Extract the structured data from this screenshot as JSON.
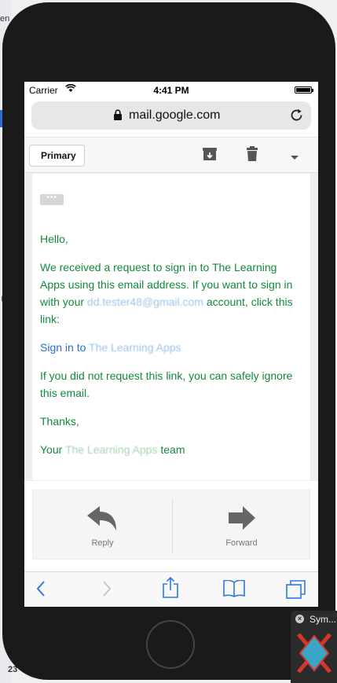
{
  "background": {
    "left_fragment_text": "en",
    "bottom_fragment_text": "23"
  },
  "status_bar": {
    "carrier": "Carrier",
    "time": "4:41 PM"
  },
  "browser": {
    "url": "mail.google.com"
  },
  "toolbar": {
    "back_label": "Primary"
  },
  "email": {
    "greeting": "Hello,",
    "body_part1": "We received a request to sign in to The Learning Apps using this email address. If you want to sign in with your ",
    "blurred_email": "dd.tester48@gmail.com",
    "body_part2": " account, click this link:",
    "link_prefix": "Sign in to ",
    "link_blurred": "The Learning Apps",
    "ignore_text": "If you did not request this link, you can safely ignore this email.",
    "thanks": "Thanks,",
    "signoff_prefix": "Your ",
    "signoff_blurred": "The Learning Apps",
    "signoff_suffix": " team"
  },
  "actions": {
    "reply_label": "Reply",
    "forward_label": "Forward"
  },
  "symbol_panel": {
    "title": "Sym..."
  },
  "colors": {
    "email_text": "#13893b",
    "link": "#2a6fd0",
    "safari_blue": "#2a7ae2"
  }
}
